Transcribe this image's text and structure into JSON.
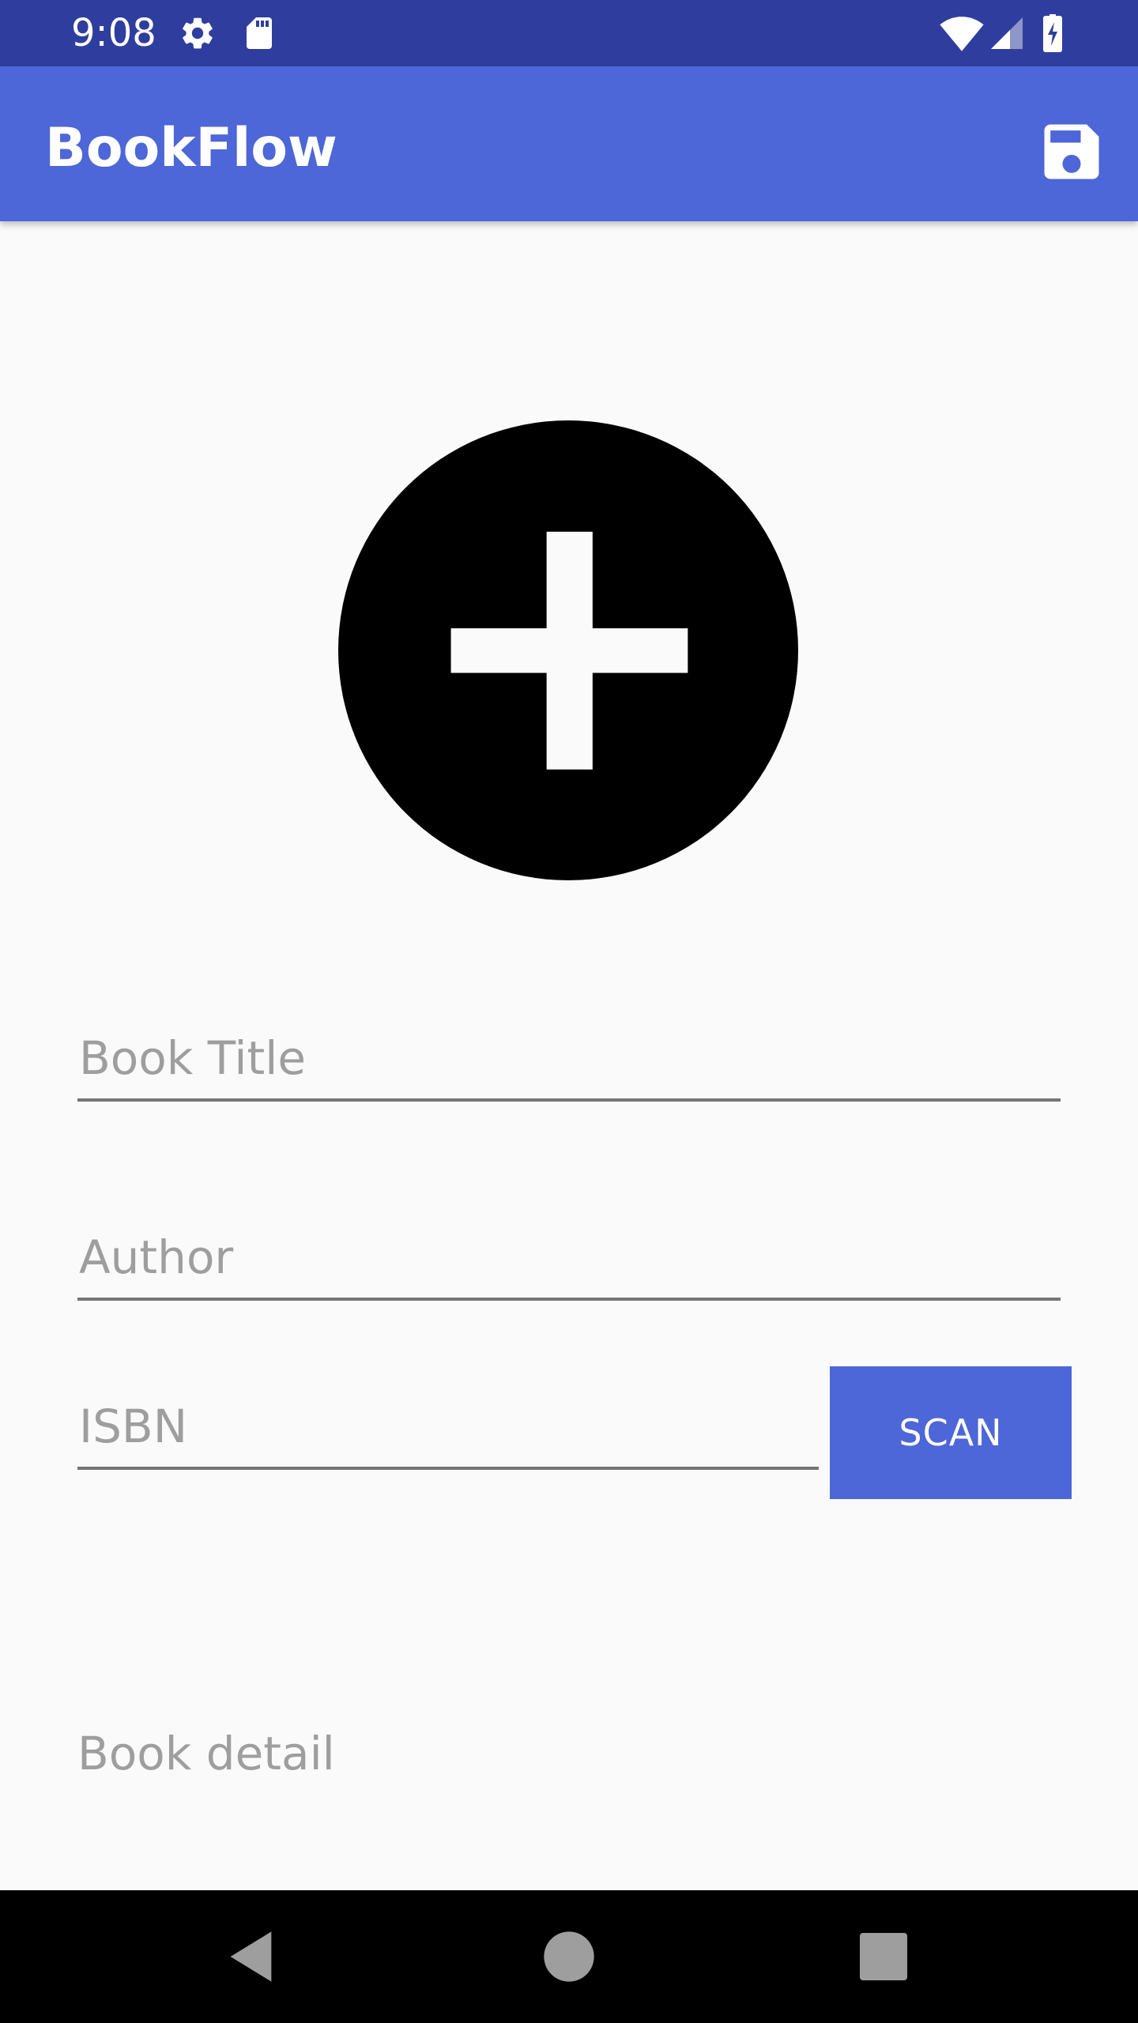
{
  "status_bar": {
    "time": "9:08",
    "icons": [
      "gear-icon",
      "sd-card-icon",
      "wifi-icon",
      "cellular-signal-icon",
      "battery-charging-icon"
    ],
    "background": "#2f3e9e"
  },
  "app_bar": {
    "title": "BookFlow",
    "action_icon": "save-icon",
    "background": "#4d66d8"
  },
  "form": {
    "add_image_icon": "add-circle-icon",
    "book_title_placeholder": "Book Title",
    "author_placeholder": "Author",
    "isbn_placeholder": "ISBN",
    "scan_label": "SCAN",
    "book_detail_label": "Book detail"
  },
  "nav_bar": {
    "icons": [
      "back-icon",
      "home-icon",
      "recents-icon"
    ]
  },
  "colors": {
    "accent": "#4d66d8",
    "status_bar": "#2f3e9e",
    "hint_text": "#9e9e9e",
    "underline": "#757575"
  }
}
